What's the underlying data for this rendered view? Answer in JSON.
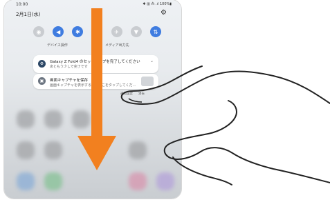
{
  "status_bar": {
    "time": "10:00",
    "icons_text": "✱ ▥ ⁂ .ıl 100%▮"
  },
  "panel": {
    "date": "2月1日(水)"
  },
  "quick_settings": {
    "tiles": [
      {
        "icon": "wifi-icon",
        "state": "off"
      },
      {
        "icon": "sound-icon",
        "state": "on"
      },
      {
        "icon": "bluetooth-icon",
        "state": "on"
      },
      {
        "icon": "autorotate-icon",
        "state": "off"
      },
      {
        "icon": "airplane-icon",
        "state": "off"
      },
      {
        "icon": "flashlight-icon",
        "state": "off"
      },
      {
        "icon": "data-icon",
        "state": "on"
      }
    ],
    "labels": {
      "left": "デバイス操作",
      "right": "メディア出力先"
    }
  },
  "notifications": [
    {
      "title": "Galaxy Z Fold4 のセットアップを完了してください",
      "body": "あともう少しで完了です"
    },
    {
      "title": "画面キャプチャを保存",
      "body": "画面キャプチャを表示するにはここをタップしてくだ..."
    }
  ],
  "bottom_labels": {
    "left": "通知設定",
    "right": "消去"
  },
  "colors": {
    "accent_on": "#3f7ce0",
    "arrow": "#f2801f"
  }
}
